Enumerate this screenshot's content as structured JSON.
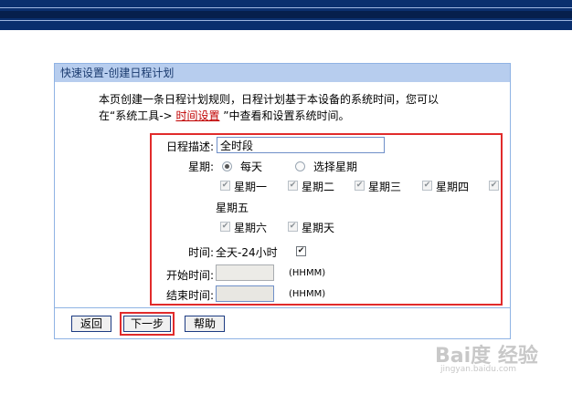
{
  "panel": {
    "title": "快速设置-创建日程计划",
    "intro_line1": "本页创建一条日程计划规则，日程计划基于本设备的系统时间，您可以",
    "intro_line2_pre": "在“系统工具->",
    "intro_link": "时间设置",
    "intro_line2_post": "”中查看和设置系统时间。"
  },
  "form": {
    "desc_label": "日程描述:",
    "desc_value": "全时段",
    "week_label": "星期:",
    "radio_everyday": "每天",
    "radio_select": "选择星期",
    "days": [
      "星期一",
      "星期二",
      "星期三",
      "星期四",
      "星期五",
      "星期六",
      "星期天"
    ],
    "time_label": "时间:",
    "all_day": "全天-24小时",
    "start_label": "开始时间:",
    "end_label": "结束时间:",
    "hhmm": "(HHMM)"
  },
  "buttons": {
    "back": "返回",
    "next": "下一步",
    "help": "帮助"
  },
  "watermark": {
    "brand": "Bai度 经验",
    "sub": "jingyan.baidu.com"
  },
  "colors": {
    "banner": "#0a2f6e",
    "panel_header": "#b7cdee",
    "highlight": "#e12b2b",
    "link": "#c00000"
  }
}
